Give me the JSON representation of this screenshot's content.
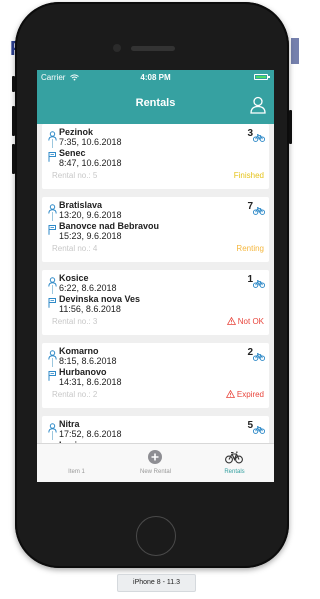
{
  "background": {
    "letter": "P"
  },
  "status_bar": {
    "carrier": "Carrier",
    "time": "4:08 PM"
  },
  "nav": {
    "title": "Rentals"
  },
  "colors": {
    "teal": "#36a1a1",
    "finished": "#e5c31a",
    "renting": "#f5b73e",
    "alert": "#e8453c",
    "icon_blue": "#2f8ac8"
  },
  "rentals": [
    {
      "from": "Pezinok",
      "from_time": "7:35, 10.6.2018",
      "to": "Senec",
      "to_time": "8:47, 10.6.2018",
      "rental_no": "Rental no.: 5",
      "bike_count": "3",
      "status": "Finished",
      "status_type": "finished"
    },
    {
      "from": "Bratislava",
      "from_time": "13:20, 9.6.2018",
      "to": "Banovce nad Bebravou",
      "to_time": "15:23, 9.6.2018",
      "rental_no": "Rental no.: 4",
      "bike_count": "7",
      "status": "Renting",
      "status_type": "renting"
    },
    {
      "from": "Kosice",
      "from_time": "6:22, 8.6.2018",
      "to": "Devinska nova Ves",
      "to_time": "11:56, 8.6.2018",
      "rental_no": "Rental no.: 3",
      "bike_count": "1",
      "status": "Not OK",
      "status_type": "alert"
    },
    {
      "from": "Komarno",
      "from_time": "8:15, 8.6.2018",
      "to": "Hurbanovo",
      "to_time": "14:31, 8.6.2018",
      "rental_no": "Rental no.: 2",
      "bike_count": "2",
      "status": "Expired",
      "status_type": "alert"
    },
    {
      "from": "Nitra",
      "from_time": "17:52, 8.6.2018",
      "to": "Levice",
      "bike_count": "5"
    }
  ],
  "tabs": [
    {
      "label": "Item 1",
      "icon": "blank-icon",
      "active": false
    },
    {
      "label": "New Rental",
      "icon": "plus-circle-icon",
      "active": false
    },
    {
      "label": "Rentals",
      "icon": "bicycle-icon",
      "active": true
    }
  ],
  "device_label": "iPhone 8 - 11.3"
}
